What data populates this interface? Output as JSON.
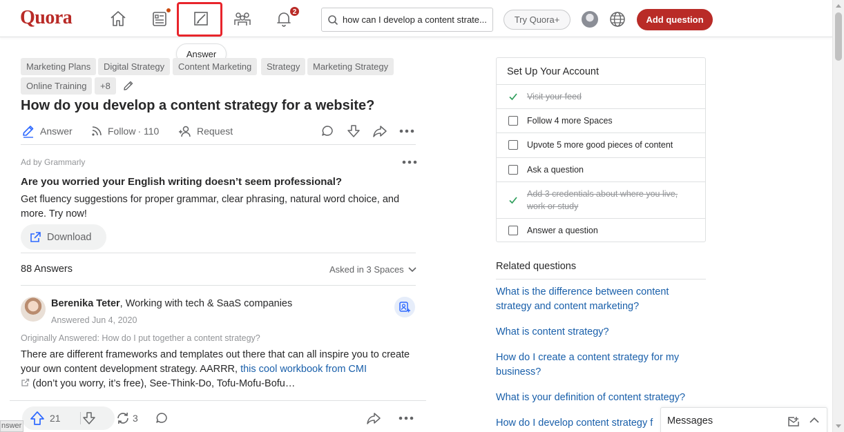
{
  "header": {
    "logo": "Quora",
    "notifications_count": "2",
    "search_value": "how can I develop a content strate...",
    "try_plus": "Try Quora+",
    "add_question": "Add question",
    "tooltip": "Answer"
  },
  "question": {
    "topics": [
      "Marketing Plans",
      "Digital Strategy",
      "Content Marketing",
      "Strategy",
      "Marketing Strategy",
      "Online Training",
      "+8"
    ],
    "title": "How do you develop a content strategy for a website?",
    "actions": {
      "answer": "Answer",
      "follow": "Follow",
      "follow_count": "· 110",
      "request": "Request"
    }
  },
  "ad": {
    "label": "Ad by Grammarly",
    "title": "Are you worried your English writing doesn’t seem professional?",
    "body": "Get fluency suggestions for proper grammar, clear phrasing, natural word choice, and more. Try now!",
    "cta": "Download"
  },
  "answers": {
    "count": "88 Answers",
    "asked_in": "Asked in 3 Spaces"
  },
  "answer": {
    "author": "Berenika Teter",
    "credential": ", Working with tech & SaaS companies",
    "date": "Answered Jun 4, 2020",
    "originally": "Originally Answered: How do I put together a content strategy?",
    "text_1": "There are different frameworks and templates out there that can all inspire you to create your own content development strategy. AARRR, ",
    "link": "this cool workbook from CMI",
    "text_2": "(don’t you worry, it’s free), See-Think-Do, Tofu-Mofu-Bofu…",
    "upvotes": "21",
    "shares": "3"
  },
  "sidebar": {
    "setup_title": "Set Up Your Account",
    "setup_items": [
      {
        "label": "Visit your feed",
        "done": true
      },
      {
        "label": "Follow 4 more Spaces",
        "done": false
      },
      {
        "label": "Upvote 5 more good pieces of content",
        "done": false
      },
      {
        "label": "Ask a question",
        "done": false
      },
      {
        "label": "Add 3 credentials about where you live, work or study",
        "done": true
      },
      {
        "label": "Answer a question",
        "done": false
      }
    ],
    "related_title": "Related questions",
    "related": [
      "What is the difference between content strategy and content marketing?",
      "What is content strategy?",
      "How do I create a content strategy for my business?",
      "What is your definition of content strategy?",
      "How do I develop content strategy f"
    ]
  },
  "messages": {
    "label": "Messages"
  },
  "corner_tab": "nswer",
  "colors": {
    "brand": "#b92b27",
    "link": "#195faa",
    "check": "#2e9e5b"
  }
}
